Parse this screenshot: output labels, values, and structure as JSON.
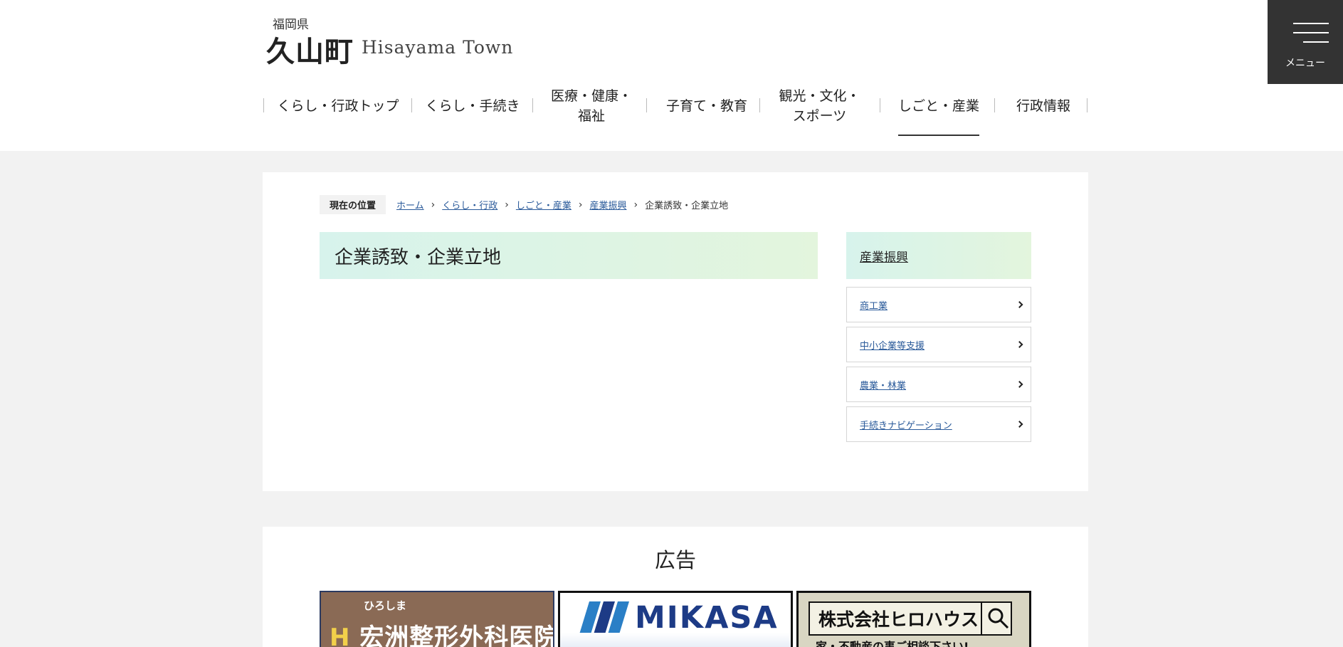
{
  "header": {
    "prefecture": "福岡県",
    "town_jp": "久山町",
    "town_en": "Hisayama Town",
    "menu_label": "メニュー"
  },
  "gnav": {
    "items": [
      {
        "label": "くらし・行政トップ"
      },
      {
        "label": "くらし・手続き"
      },
      {
        "label": "医療・健康・\n福祉"
      },
      {
        "label": "子育て・教育"
      },
      {
        "label": "観光・文化・\nスポーツ"
      },
      {
        "label": "しごと・産業",
        "active": true
      },
      {
        "label": "行政情報"
      }
    ]
  },
  "breadcrumb": {
    "here_label": "現在の位置",
    "links": [
      "ホーム",
      "くらし・行政",
      "しごと・産業",
      "産業振興"
    ],
    "current": "企業誘致・企業立地"
  },
  "page": {
    "title": "企業誘致・企業立地"
  },
  "side_nav": {
    "heading": "産業振興",
    "items": [
      "商工業",
      "中小企業等支援",
      "農業・林業",
      "手続きナビゲーション"
    ]
  },
  "ads": {
    "heading": "広告",
    "banners": [
      {
        "sub": "ひろしま",
        "main_yellow": "H",
        "main": "宏洲整形外科医院"
      },
      {
        "name": "MIKASA"
      },
      {
        "company": "株式会社ヒロハウス",
        "tagline": "家・不動産の事ご相談下さい!"
      }
    ]
  },
  "colors": {
    "menu_bg": "#333333",
    "title_gradient_start": "#d7f3ec",
    "title_gradient_end": "#e3f5dd",
    "link": "#2a5a9a",
    "page_bg": "#f2f2f2"
  }
}
